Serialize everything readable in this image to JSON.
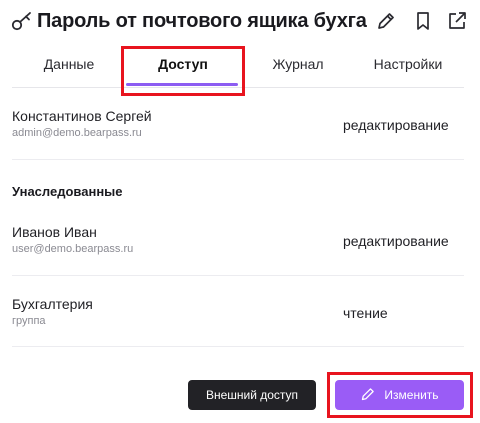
{
  "header": {
    "title": "Пароль от почтового ящика бухгал...",
    "icons": [
      "key-icon",
      "edit-icon",
      "bookmark-icon",
      "open-external-icon"
    ]
  },
  "tabs": [
    {
      "label": "Данные",
      "active": false
    },
    {
      "label": "Доступ",
      "active": true
    },
    {
      "label": "Журнал",
      "active": false
    },
    {
      "label": "Настройки",
      "active": false
    }
  ],
  "direct_access": [
    {
      "name": "Константинов Сергей",
      "sub": "admin@demo.bearpass.ru",
      "permission": "редактирование"
    }
  ],
  "inherited": {
    "title": "Унаследованные",
    "items": [
      {
        "name": "Иванов Иван",
        "sub": "user@demo.bearpass.ru",
        "permission": "редактирование"
      },
      {
        "name": "Бухгалтерия",
        "sub": "группа",
        "permission": "чтение"
      }
    ]
  },
  "actions": {
    "external_access": "Внешний доступ",
    "change": "Изменить"
  },
  "colors": {
    "accent": "#9a5cf6",
    "dark_button": "#222226",
    "highlight": "#e8141e"
  }
}
